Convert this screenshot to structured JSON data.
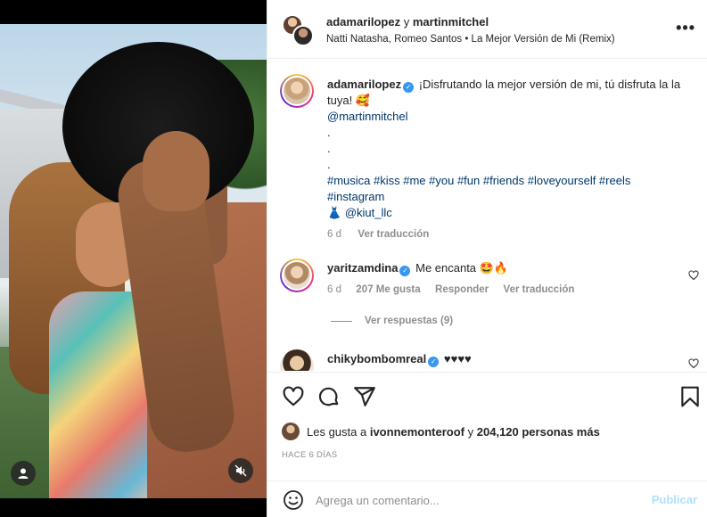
{
  "header": {
    "user1": "adamarilopez",
    "conjunction": "y",
    "user2": "martinmitchel",
    "audio": "Natti Natasha, Romeo Santos • La Mejor Versión de Mi (Remix)",
    "more_icon": "more-horizontal-icon"
  },
  "caption": {
    "username": "adamarilopez",
    "text": "¡Disfrutando la mejor versión de mi, tú disfruta la la tuya! 🥰",
    "mention": "@martinmitchel",
    "dot1": ".",
    "dot2": ".",
    "dot3": ".",
    "hashtags": "#musica #kiss #me #you #fun #friends #loveyourself #reels #instagram",
    "credit_emoji": "👗",
    "credit": "@kiut_llc",
    "time": "6 d",
    "translate": "Ver traducción"
  },
  "comments": [
    {
      "username": "yaritzamdina",
      "text": "Me encanta 🤩🔥",
      "time": "6 d",
      "likes": "207 Me gusta",
      "reply": "Responder",
      "translate": "Ver traducción",
      "view_replies": "Ver respuestas (9)"
    },
    {
      "username": "chikybombomreal",
      "text": "♥♥♥♥"
    }
  ],
  "likes": {
    "prefix": "Les gusta a",
    "user": "ivonnemonteroof",
    "and": "y",
    "count": "204,120 personas más"
  },
  "date": "HACE 6 DÍAS",
  "add_comment": {
    "placeholder": "Agrega un comentario...",
    "post": "Publicar"
  },
  "colors": {
    "link": "#00376b",
    "secondary": "#8e8e8e",
    "verified": "#3897f0",
    "post_disabled": "#b2dffc"
  }
}
